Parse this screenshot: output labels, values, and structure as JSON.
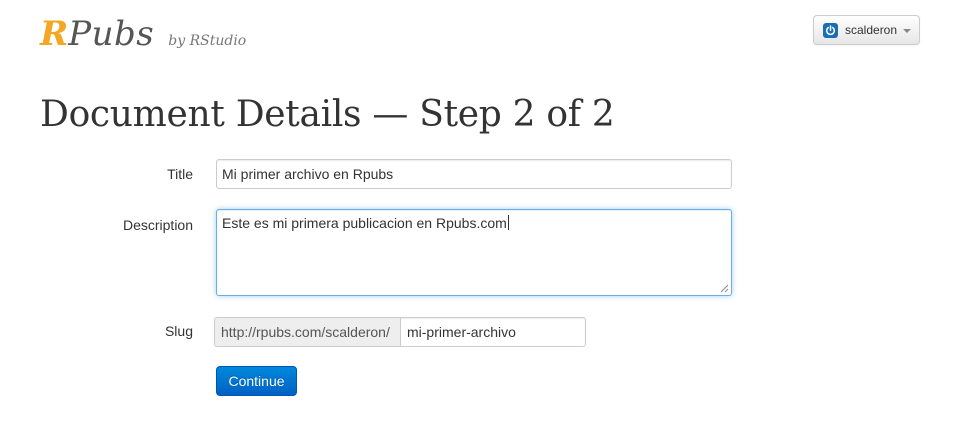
{
  "header": {
    "logo_r": "R",
    "logo_pubs": "Pubs",
    "logo_by": "by RStudio",
    "user_menu": {
      "username": "scalderon",
      "icon": "power-icon",
      "dropdown_icon": "chevron-down-icon"
    }
  },
  "main": {
    "title": "Document Details — Step 2 of 2",
    "form": {
      "title_label": "Title",
      "title_value": "Mi primer archivo en Rpubs",
      "description_label": "Description",
      "description_value": "Este es mi primera publicacion en Rpubs.com",
      "slug_label": "Slug",
      "slug_prefix": "http://rpubs.com/scalderon/",
      "slug_value": "mi-primer-archivo",
      "submit_label": "Continue"
    }
  },
  "colors": {
    "logo_accent": "#f5a623",
    "primary_button": "#0070d0",
    "focus_border": "#66afe9"
  }
}
